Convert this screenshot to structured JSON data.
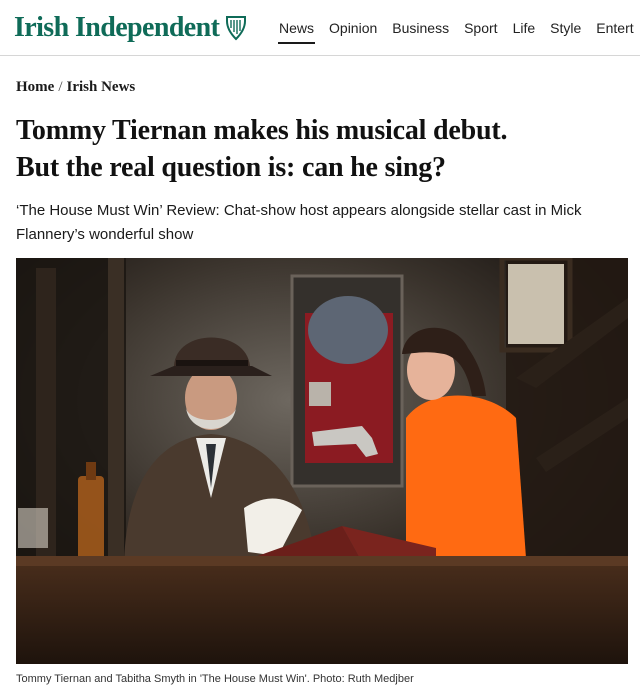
{
  "masthead": {
    "logo_text": "Irish Independent",
    "logo_icon": "harp-icon",
    "brand_color": "#0f6b58"
  },
  "nav": {
    "items": [
      {
        "label": "News",
        "active": true
      },
      {
        "label": "Opinion"
      },
      {
        "label": "Business"
      },
      {
        "label": "Sport"
      },
      {
        "label": "Life"
      },
      {
        "label": "Style"
      },
      {
        "label": "Entert"
      }
    ]
  },
  "breadcrumb": {
    "home": "Home",
    "separator": "/",
    "section": "Irish News"
  },
  "article": {
    "headline_line1": "Tommy Tiernan makes his musical debut.",
    "headline_line2": "But the real question is: can he sing?",
    "standfirst": "‘The House Must Win’ Review: Chat-show host appears alongside stellar cast in Mick Flannery’s wonderful show",
    "image_caption": "Tommy Tiernan and Tabitha Smyth in 'The House Must Win'. Photo: Ruth Medjber"
  }
}
